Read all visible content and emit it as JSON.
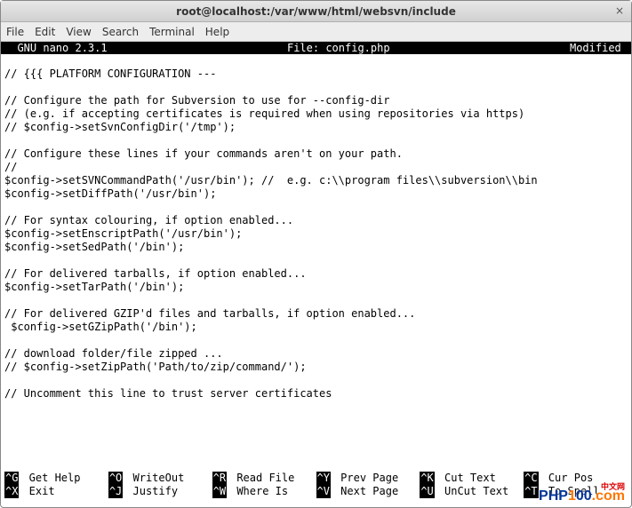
{
  "window": {
    "title": "root@localhost:/var/www/html/websvn/include",
    "close_icon": "×"
  },
  "menu": {
    "items": [
      "File",
      "Edit",
      "View",
      "Search",
      "Terminal",
      "Help"
    ]
  },
  "nano_header": {
    "version": "  GNU nano 2.3.1",
    "file_label": "File: config.php",
    "status": "Modified "
  },
  "editor_lines": [
    "",
    "// {{{ PLATFORM CONFIGURATION ---",
    "",
    "// Configure the path for Subversion to use for --config-dir",
    "// (e.g. if accepting certificates is required when using repositories via https)",
    "// $config->setSvnConfigDir('/tmp');",
    "",
    "// Configure these lines if your commands aren't on your path.",
    "//",
    "$config->setSVNCommandPath('/usr/bin'); //  e.g. c:\\\\program files\\\\subversion\\\\bin",
    "$config->setDiffPath('/usr/bin');",
    "",
    "// For syntax colouring, if option enabled...",
    "$config->setEnscriptPath('/usr/bin');",
    "$config->setSedPath('/bin');",
    "",
    "// For delivered tarballs, if option enabled...",
    "$config->setTarPath('/bin');",
    "",
    "// For delivered GZIP'd files and tarballs, if option enabled...",
    " $config->setGZipPath('/bin');",
    "",
    "// download folder/file zipped ...",
    "// $config->setZipPath('Path/to/zip/command/');",
    "",
    "// Uncomment this line to trust server certificates",
    ""
  ],
  "shortcuts_row1": [
    {
      "key": "^G",
      "label": "Get Help"
    },
    {
      "key": "^O",
      "label": "WriteOut"
    },
    {
      "key": "^R",
      "label": "Read File"
    },
    {
      "key": "^Y",
      "label": "Prev Page"
    },
    {
      "key": "^K",
      "label": "Cut Text"
    },
    {
      "key": "^C",
      "label": "Cur Pos"
    }
  ],
  "shortcuts_row2": [
    {
      "key": "^X",
      "label": "Exit"
    },
    {
      "key": "^J",
      "label": "Justify"
    },
    {
      "key": "^W",
      "label": "Where Is"
    },
    {
      "key": "^V",
      "label": "Next Page"
    },
    {
      "key": "^U",
      "label": "UnCut Text"
    },
    {
      "key": "^T",
      "label": "To Spell"
    }
  ],
  "watermark": {
    "small": "中文网",
    "text1": "PHP",
    "text2": "1",
    "text3": "00",
    "text4": ".com"
  }
}
